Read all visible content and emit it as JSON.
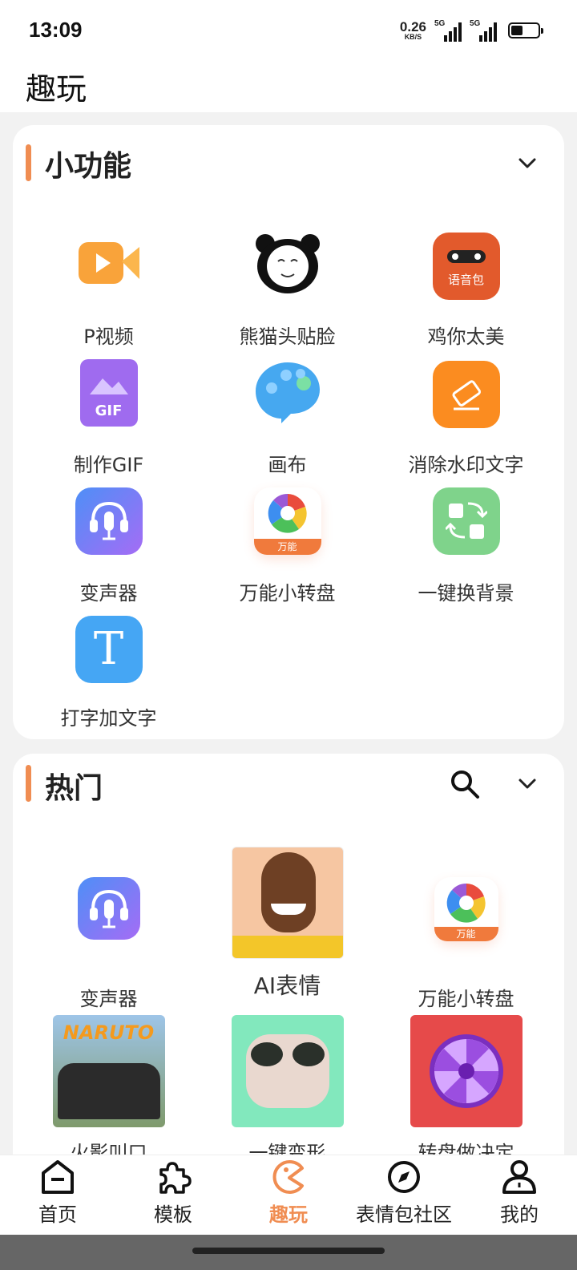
{
  "status_bar": {
    "time": "13:09",
    "speed_value": "0.26",
    "speed_unit": "KB/S",
    "sig1": "5G",
    "sig2": "5G"
  },
  "app_title": "趣玩",
  "section1": {
    "title": "小功能",
    "items": [
      {
        "label": "P视频",
        "icon": "video-camera-icon"
      },
      {
        "label": "熊猫头贴脸",
        "icon": "panda-face-icon"
      },
      {
        "label": "鸡你太美",
        "icon": "voice-pack-icon",
        "badge": "语音包"
      },
      {
        "label": "制作GIF",
        "icon": "gif-file-icon",
        "badge": "GIF"
      },
      {
        "label": "画布",
        "icon": "palette-icon"
      },
      {
        "label": "消除水印文字",
        "icon": "eraser-icon"
      },
      {
        "label": "变声器",
        "icon": "microphone-icon"
      },
      {
        "label": "万能小转盘",
        "icon": "spin-wheel-icon",
        "badge": "万能"
      },
      {
        "label": "一键换背景",
        "icon": "swap-background-icon"
      },
      {
        "label": "打字加文字",
        "icon": "text-t-icon",
        "badge": "T"
      }
    ]
  },
  "section2": {
    "title": "热门",
    "items": [
      {
        "label": "变声器",
        "icon": "microphone-icon"
      },
      {
        "label": "AI表情",
        "icon": "ai-face-thumbnail"
      },
      {
        "label": "万能小转盘",
        "icon": "spin-wheel-icon",
        "badge": "万能"
      },
      {
        "label": "火影叫口",
        "icon": "naruto-thumbnail",
        "badge": "NARUTO"
      },
      {
        "label": "一键变形",
        "icon": "alien-face-thumbnail"
      },
      {
        "label": "转盘做决定",
        "icon": "purple-wheel-thumbnail"
      }
    ]
  },
  "nav": [
    {
      "label": "首页",
      "icon": "home-icon"
    },
    {
      "label": "模板",
      "icon": "puzzle-icon"
    },
    {
      "label": "趣玩",
      "icon": "pacman-icon",
      "active": true
    },
    {
      "label": "表情包社区",
      "icon": "compass-icon"
    },
    {
      "label": "我的",
      "icon": "profile-icon"
    }
  ],
  "colors": {
    "accent": "#f08d52",
    "card": "#ffffff",
    "background": "#f2f2f2"
  }
}
